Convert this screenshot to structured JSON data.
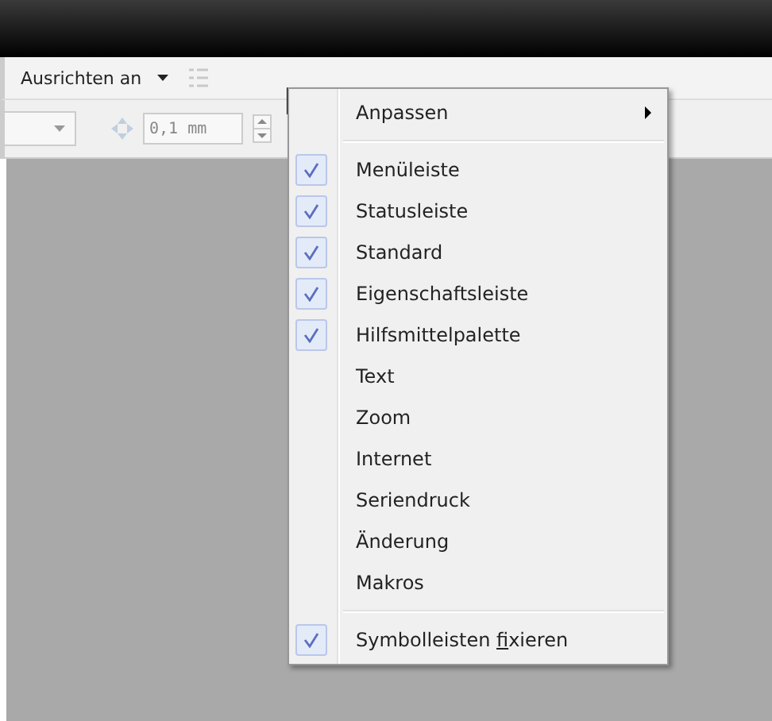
{
  "toolbar": {
    "align_label": "Ausrichten an",
    "nudge_value": "0,1 mm"
  },
  "context_menu": {
    "items": [
      {
        "kind": "submenu",
        "label": "Anpassen"
      },
      {
        "kind": "separator"
      },
      {
        "kind": "check",
        "label": "Menüleiste",
        "checked": true
      },
      {
        "kind": "check",
        "label": "Statusleiste",
        "checked": true
      },
      {
        "kind": "check",
        "label": "Standard",
        "checked": true
      },
      {
        "kind": "check",
        "label": "Eigenschaftsleiste",
        "checked": true
      },
      {
        "kind": "check",
        "label": "Hilfsmittelpalette",
        "checked": true
      },
      {
        "kind": "check",
        "label": "Text",
        "checked": false
      },
      {
        "kind": "check",
        "label": "Zoom",
        "checked": false
      },
      {
        "kind": "check",
        "label": "Internet",
        "checked": false
      },
      {
        "kind": "check",
        "label": "Seriendruck",
        "checked": false
      },
      {
        "kind": "check",
        "label": "Änderung",
        "checked": false
      },
      {
        "kind": "check",
        "label": "Makros",
        "checked": false
      },
      {
        "kind": "separator"
      },
      {
        "kind": "check",
        "label_before": "Symbolleisten ",
        "accelerator": "f",
        "label_after": "ixieren",
        "checked": true
      }
    ]
  }
}
